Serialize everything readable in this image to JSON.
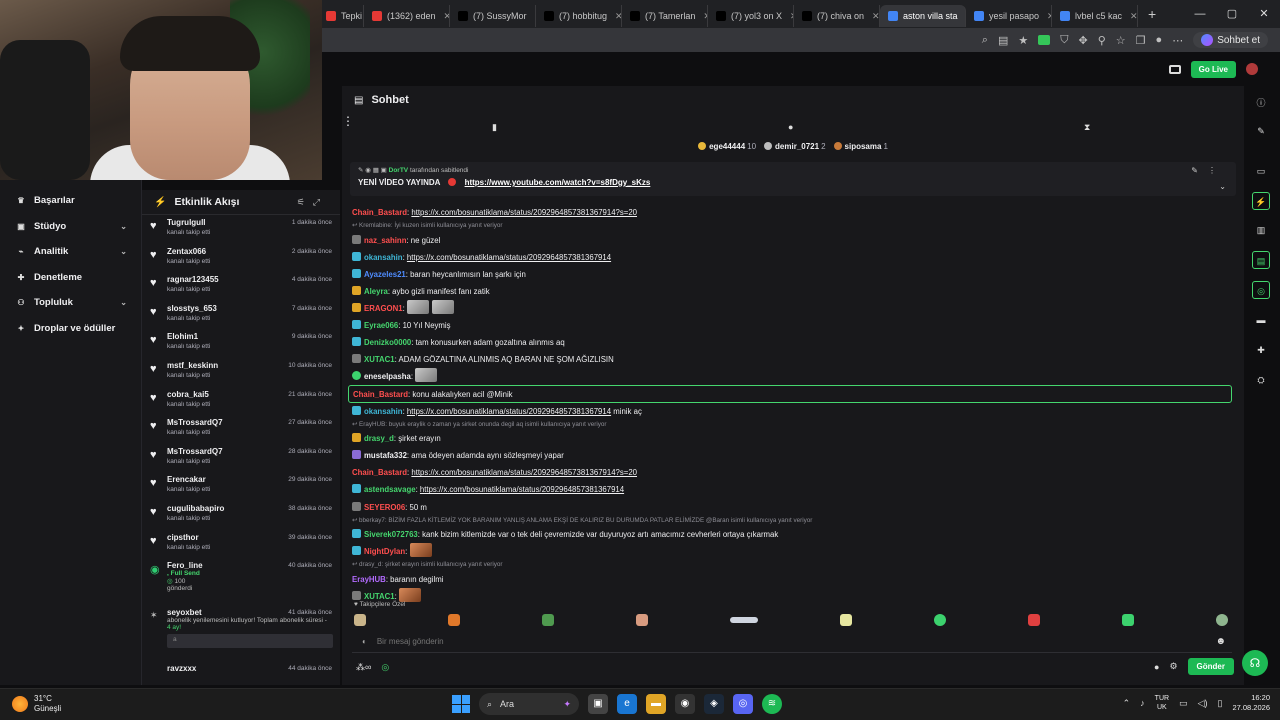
{
  "browser": {
    "tabs": [
      {
        "label": "Tepki",
        "fav": "#e53935",
        "active": false
      },
      {
        "label": "(1362) eden",
        "fav": "#e53935",
        "active": false
      },
      {
        "label": "(7) SussyMor",
        "fav": "#000000",
        "active": false
      },
      {
        "label": "(7) hobbitug",
        "fav": "#000000",
        "active": false
      },
      {
        "label": "(7) Tamerlan",
        "fav": "#000000",
        "active": false
      },
      {
        "label": "(7) yol3 on X",
        "fav": "#000000",
        "active": false
      },
      {
        "label": "(7) chiva on",
        "fav": "#000000",
        "active": false
      },
      {
        "label": "aston villa sta",
        "fav": "#4285f4",
        "active": true
      },
      {
        "label": "yesil pasapo",
        "fav": "#4285f4",
        "active": false
      },
      {
        "label": "lvbel c5 kac",
        "fav": "#4285f4",
        "active": false
      }
    ],
    "new_tab": "+",
    "profile_name": "Sohbet et"
  },
  "twitch": {
    "go_live": "Go Live"
  },
  "nav": {
    "items": [
      {
        "label": "Başarılar",
        "icon": "trophy-icon",
        "chev": false
      },
      {
        "label": "Stüdyo",
        "icon": "studio-icon",
        "chev": true
      },
      {
        "label": "Analitik",
        "icon": "analytics-icon",
        "chev": true
      },
      {
        "label": "Denetleme",
        "icon": "wrench-icon",
        "chev": false
      },
      {
        "label": "Topluluk",
        "icon": "community-icon",
        "chev": true
      },
      {
        "label": "Droplar ve ödüller",
        "icon": "gift-icon",
        "chev": false
      }
    ]
  },
  "activity": {
    "title": "Etkinlik Akışı",
    "events": [
      {
        "user": "Tugrulgull",
        "sub": "kanalı takip etti",
        "ago": "1 dakika önce"
      },
      {
        "user": "Zentax066",
        "sub": "kanalı takip etti",
        "ago": "2 dakika önce"
      },
      {
        "user": "ragnar123455",
        "sub": "kanalı takip etti",
        "ago": "4 dakika önce"
      },
      {
        "user": "slosstys_653",
        "sub": "kanalı takip etti",
        "ago": "7 dakika önce"
      },
      {
        "user": "Elohim1",
        "sub": "kanalı takip etti",
        "ago": "9 dakika önce"
      },
      {
        "user": "mstf_keskinn",
        "sub": "kanalı takip etti",
        "ago": "10 dakika önce"
      },
      {
        "user": "cobra_kai5",
        "sub": "kanalı takip etti",
        "ago": "21 dakika önce"
      },
      {
        "user": "MsTrossardQ7",
        "sub": "kanalı takip etti",
        "ago": "27 dakika önce"
      },
      {
        "user": "MsTrossardQ7",
        "sub": "kanalı takip etti",
        "ago": "28 dakika önce"
      },
      {
        "user": "Erencakar",
        "sub": "kanalı takip etti",
        "ago": "29 dakika önce"
      },
      {
        "user": "cugulibabapiro",
        "sub": "kanalı takip etti",
        "ago": "38 dakika önce"
      },
      {
        "user": "cipsthor",
        "sub": "kanalı takip etti",
        "ago": "39 dakika önce"
      }
    ],
    "special": {
      "user": "Fero_line",
      "line1": ", Full Send",
      "line2": "100",
      "line3": "gönderdi",
      "ago": "40 dakika önce"
    },
    "sub_event": {
      "user": "seyoxbet",
      "text": "abonelik yenilemesini kutluyor! Toplam abonelik süresi -",
      "months": "4 ay!",
      "ago": "41 dakika önce",
      "msg": "a"
    },
    "last": {
      "user": "ravzxxx",
      "ago": "44 dakika önce"
    }
  },
  "chat": {
    "title": "Sohbet",
    "leaders": [
      {
        "name": "ege44444",
        "count": "10",
        "medal": "gold"
      },
      {
        "name": "demir_0721",
        "count": "2",
        "medal": "silver"
      },
      {
        "name": "siposama",
        "count": "1",
        "medal": "bronze"
      }
    ],
    "pinned": {
      "by_user": "DorTV",
      "by_text": "tarafından sabitlendi",
      "text": "YENİ VİDEO YAYINDA",
      "link": "https://www.youtube.com/watch?v=s8fDgy_sKzs"
    },
    "messages": [
      {
        "user": "Chain_Bastard",
        "color": "#ff4f4f",
        "badge": "",
        "text": ":",
        "link": "https://x.com/bosunatiklama/status/2092964857381367914?s=20",
        "after": ""
      },
      {
        "reply": "Kremlabine: İyi kuzen isimli kullanıcıya yanıt veriyor"
      },
      {
        "user": "naz_sahinn",
        "color": "#ff4f4f",
        "badge": "gray",
        "text": ": ne güzel",
        "link": "",
        "after": ""
      },
      {
        "user": "okansahin",
        "color": "#3fb6d6",
        "badge": "blue",
        "text": ":",
        "link": "https://x.com/bosunatiklama/status/2092964857381367914",
        "after": ""
      },
      {
        "user": "Ayazeles21",
        "color": "#4f8cff",
        "badge": "blue",
        "text": ": baran heycanlımısın lan şarkı için",
        "link": "",
        "after": ""
      },
      {
        "user": "Aleyra",
        "color": "#45d66e",
        "badge": "gold",
        "text": ": aybo gizli manifest fanı zatik",
        "link": "",
        "after": ""
      },
      {
        "user": "ERAGON1",
        "color": "#ff4f4f",
        "badge": "gold",
        "text": ":",
        "link": "",
        "after": "",
        "emotes": 2
      },
      {
        "user": "Eyrae066",
        "color": "#45d66e",
        "badge": "blue",
        "text": ": 10 Yıl Neymiş",
        "link": "",
        "after": ""
      },
      {
        "user": "Denizko0000",
        "color": "#45d66e",
        "badge": "blue",
        "text": ": tam konusurken adam gozaltına alınmıs aq",
        "link": "",
        "after": ""
      },
      {
        "user": "XUTAC1",
        "color": "#45d66e",
        "badge": "gray",
        "text": ": ADAM GÖZALTINA ALINMIS AQ BARAN NE ŞOM AĞIZLISIN",
        "link": "",
        "after": ""
      },
      {
        "user": "eneselpasha",
        "color": "#efeff1",
        "badge": "green",
        "text": ":",
        "link": "",
        "after": "",
        "emotes": 1
      },
      {
        "user": "Chain_Bastard",
        "color": "#ff4f4f",
        "badge": "",
        "text": ": konu alakalıyken acil @Minik",
        "link": "",
        "after": "",
        "highlight": true
      },
      {
        "user": "okansahin",
        "color": "#3fb6d6",
        "badge": "blue",
        "text": ":",
        "link": "https://x.com/bosunatiklama/status/2092964857381367914",
        "after": " minik aç"
      },
      {
        "reply": "ErayHUB: buyuk eraylik o zaman ya sirket onunda degil aq isimli kullanıcıya yanıt veriyor"
      },
      {
        "user": "drasy_d",
        "color": "#45d66e",
        "badge": "gold",
        "text": ": şirket erayın",
        "link": "",
        "after": ""
      },
      {
        "user": "mustafa332",
        "color": "#efeff1",
        "badge": "purple",
        "text": ": ama ödeyen adamda aynı sözleşmeyi yapar",
        "link": "",
        "after": ""
      },
      {
        "user": "Chain_Bastard",
        "color": "#ff4f4f",
        "badge": "",
        "text": ":",
        "link": "https://x.com/bosunatiklama/status/2092964857381367914?s=20",
        "after": ""
      },
      {
        "user": "astendsavage",
        "color": "#45d66e",
        "badge": "blue",
        "text": ":",
        "link": "https://x.com/bosunatiklama/status/2092964857381367914",
        "after": ""
      },
      {
        "user": "SEYERO06",
        "color": "#ff4f4f",
        "badge": "gray",
        "text": ": 50 m",
        "link": "",
        "after": ""
      },
      {
        "reply": "bberkay7: BİZİM FAZLA KİTLEMİZ YOK BARANIM YANLIŞ ANLAMA EKŞİ DE KALIRIZ BU DURUMDA PATLAR ELİMİZDE @Baran isimli kullanıcıya yanıt veriyor"
      },
      {
        "user": "Siverek072763",
        "color": "#45d66e",
        "badge": "blue",
        "text": ": kank bizim kitlemizde var o tek deli çevremizde var duyuruyoz artı amacımız cevherleri ortaya çıkarmak",
        "link": "",
        "after": ""
      },
      {
        "user": "NightDylan",
        "color": "#ff4f4f",
        "badge": "blue",
        "text": ":",
        "link": "",
        "after": "",
        "emotes": 1,
        "warm": true
      },
      {
        "reply": "drasy_d: şirket erayın isimli kullanıcıya yanıt veriyor"
      },
      {
        "user": "ErayHUB",
        "color": "#b36bff",
        "badge": "",
        "text": ": baranın degilmi",
        "link": "",
        "after": ""
      },
      {
        "user": "XUTAC1",
        "color": "#45d66e",
        "badge": "gray",
        "text": ":",
        "link": "",
        "after": "",
        "emotes": 1,
        "warm": true
      }
    ],
    "followers_only": "Takipçilere Özel",
    "input_placeholder": "Bir mesaj gönderin",
    "send_label": "Gönder"
  },
  "taskbar": {
    "temp": "31°C",
    "weather": "Güneşli",
    "search": "Ara",
    "lang1": "TUR",
    "lang2": "UK",
    "time": "16:20",
    "date": "27.08.2026"
  }
}
